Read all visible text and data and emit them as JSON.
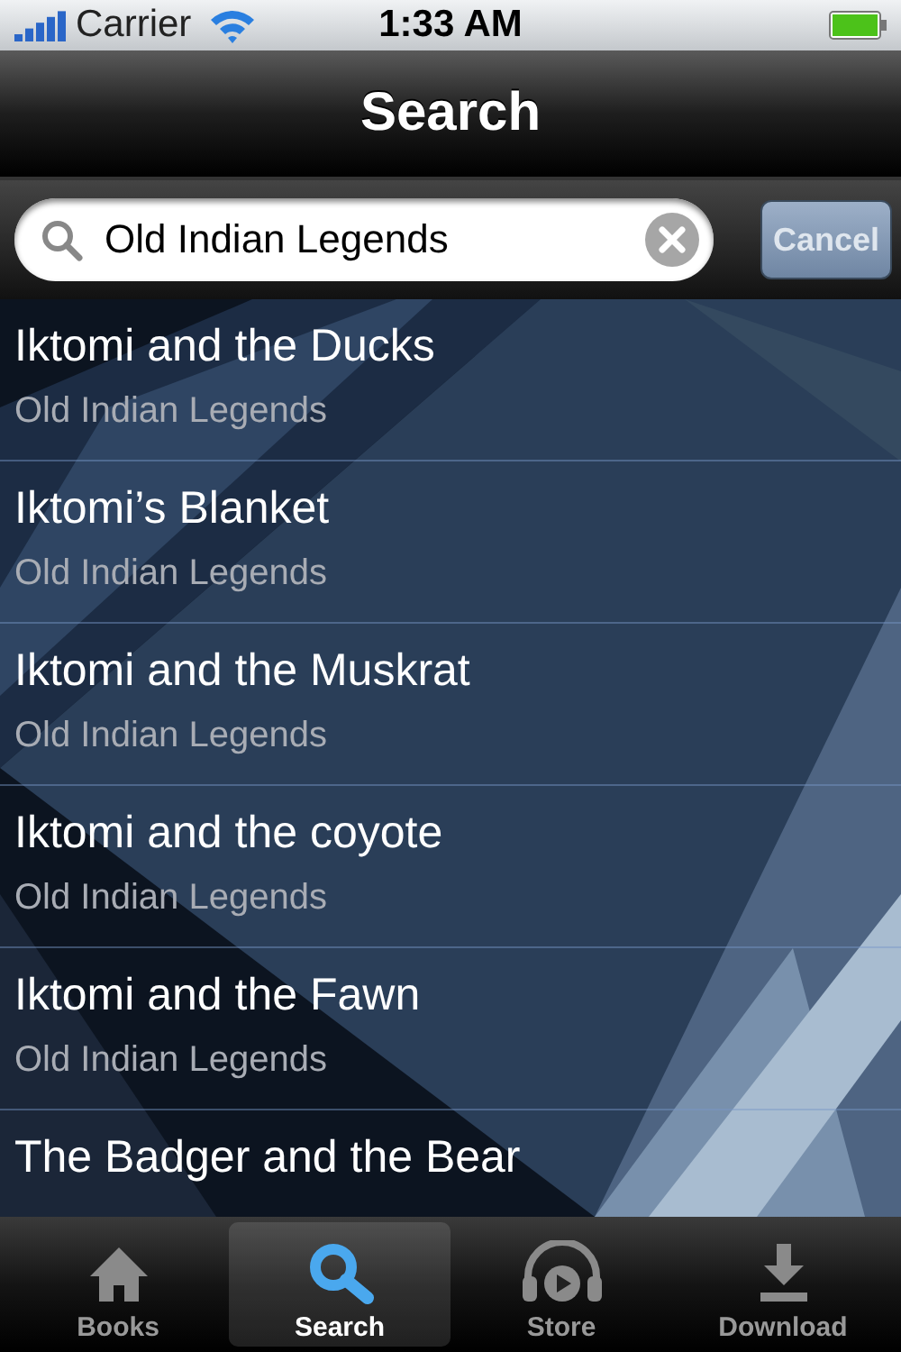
{
  "status_bar": {
    "carrier": "Carrier",
    "time": "1:33 AM"
  },
  "nav_bar": {
    "title": "Search"
  },
  "search": {
    "value": "Old Indian Legends",
    "cancel": "Cancel"
  },
  "results": [
    {
      "title": "Iktomi and the Ducks",
      "subtitle": "Old Indian Legends"
    },
    {
      "title": "Iktomi’s Blanket",
      "subtitle": "Old Indian Legends"
    },
    {
      "title": "Iktomi and the Muskrat",
      "subtitle": "Old Indian Legends"
    },
    {
      "title": "Iktomi and the coyote",
      "subtitle": "Old Indian Legends"
    },
    {
      "title": "Iktomi and the Fawn",
      "subtitle": "Old Indian Legends"
    },
    {
      "title": "The Badger and the Bear"
    }
  ],
  "tabs": [
    {
      "kind": "home",
      "label": "Books",
      "selected": false
    },
    {
      "kind": "search",
      "label": "Search",
      "selected": true
    },
    {
      "kind": "headphones",
      "label": "Store",
      "selected": false
    },
    {
      "kind": "download",
      "label": "Download",
      "selected": false
    }
  ]
}
